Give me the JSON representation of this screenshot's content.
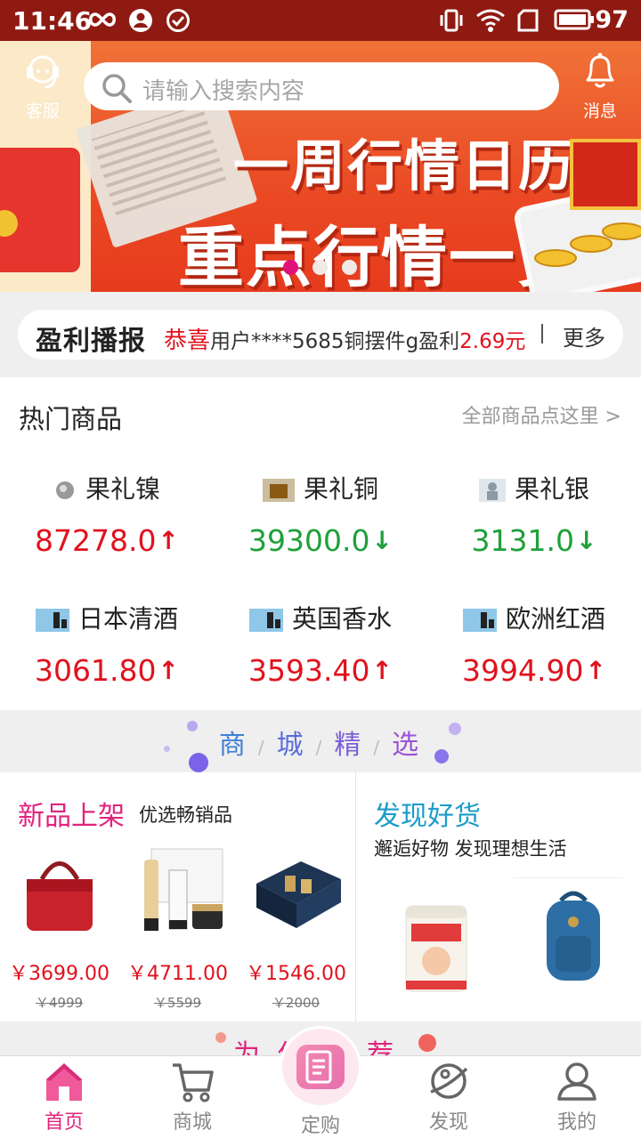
{
  "status_bar": {
    "time": "11:46",
    "battery": "97"
  },
  "header": {
    "service_label": "客服",
    "search_placeholder": "请输入搜索内容",
    "message_label": "消息"
  },
  "banner": {
    "line1": "一周行情日历",
    "line2": "重点行情一览",
    "active_dot": 0,
    "dot_count": 3
  },
  "ticker": {
    "brand": "盈利播报",
    "congrats": "恭喜",
    "user_text": "用户****5685铜摆件",
    "g": "g",
    "profit_text": "盈利",
    "amount": "2.69元",
    "more": "更多"
  },
  "hot": {
    "title": "热门商品",
    "all_link": "全部商品点这里 >",
    "items": [
      {
        "name": "果礼镍",
        "price": "87278.0",
        "trend": "up"
      },
      {
        "name": "果礼铜",
        "price": "39300.0",
        "trend": "down"
      },
      {
        "name": "果礼银",
        "price": "3131.0",
        "trend": "down"
      },
      {
        "name": "日本清酒",
        "price": "3061.80",
        "trend": "up"
      },
      {
        "name": "英国香水",
        "price": "3593.40",
        "trend": "up"
      },
      {
        "name": "欧洲红酒",
        "price": "3994.90",
        "trend": "up"
      }
    ]
  },
  "mall": {
    "chars": [
      "商",
      "城",
      "精",
      "选"
    ],
    "sep": "/"
  },
  "new_products": {
    "title": "新品上架",
    "subtitle": "优选畅销品",
    "items": [
      {
        "price": "￥3699.00",
        "old_price": "￥4999",
        "image": "red-handbag"
      },
      {
        "price": "￥4711.00",
        "old_price": "￥5599",
        "image": "chanel-cosmetics-set"
      },
      {
        "price": "￥1546.00",
        "old_price": "￥2000",
        "image": "gift-box-set"
      }
    ]
  },
  "discover": {
    "title": "发现好货",
    "subtitle": "邂逅好物 发现理想生活",
    "images": [
      "milk-powder-can",
      "blue-backpack"
    ]
  },
  "next_section_partial": "为你推荐",
  "nav": {
    "items": [
      {
        "label": "首页",
        "icon": "home-icon",
        "active": true
      },
      {
        "label": "商城",
        "icon": "cart-icon",
        "active": false
      },
      {
        "label": "定购",
        "icon": "order-icon",
        "active": false
      },
      {
        "label": "发现",
        "icon": "planet-icon",
        "active": false
      },
      {
        "label": "我的",
        "icon": "user-icon",
        "active": false
      }
    ]
  },
  "colors": {
    "status_bar": "#8e1a12",
    "up": "#e0121d",
    "down": "#1ea03a",
    "accent_pink": "#e0247c"
  }
}
